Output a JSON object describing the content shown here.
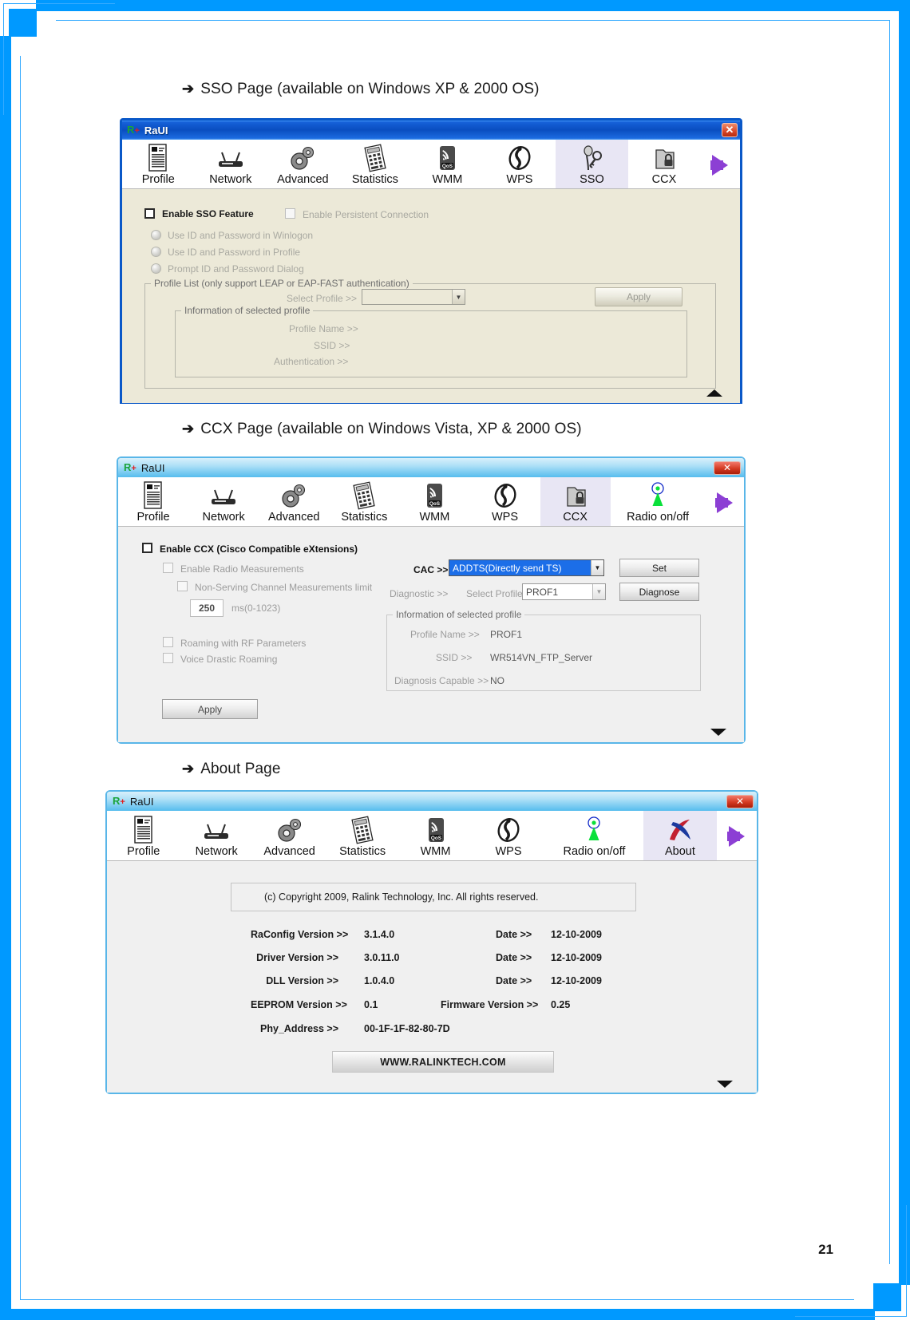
{
  "page": {
    "number": "21"
  },
  "sections": [
    {
      "id": "sso",
      "heading": "SSO Page (available on Windows XP & 2000 OS)"
    },
    {
      "id": "ccx",
      "heading": "CCX Page (available on Windows Vista, XP & 2000 OS)"
    },
    {
      "id": "about",
      "heading": "About Page"
    }
  ],
  "sso_window": {
    "title": "RaUI",
    "close_label": "✕",
    "tabs": [
      {
        "label": "Profile",
        "icon": "profile-icon",
        "selected": false
      },
      {
        "label": "Network",
        "icon": "network-icon",
        "selected": false
      },
      {
        "label": "Advanced",
        "icon": "advanced-icon",
        "selected": false
      },
      {
        "label": "Statistics",
        "icon": "statistics-icon",
        "selected": false
      },
      {
        "label": "WMM",
        "icon": "wmm-qos-icon",
        "selected": false
      },
      {
        "label": "WPS",
        "icon": "wps-icon",
        "selected": false
      },
      {
        "label": "SSO",
        "icon": "sso-icon",
        "selected": true
      },
      {
        "label": "CCX",
        "icon": "ccx-icon",
        "selected": false
      }
    ],
    "enable_sso": "Enable SSO Feature",
    "enable_persistent": "Enable Persistent Connection",
    "radios": [
      "Use ID and Password in Winlogon",
      "Use ID and Password in Profile",
      "Prompt ID and Password Dialog"
    ],
    "profile_list_title": "Profile List (only support LEAP or EAP-FAST authentication)",
    "select_profile_label": "Select Profile >>",
    "select_profile_value": "",
    "apply_label": "Apply",
    "info_group_title": "Information of selected profile",
    "info_rows": [
      {
        "label": "Profile Name >>",
        "value": ""
      },
      {
        "label": "SSID >>",
        "value": ""
      },
      {
        "label": "Authentication >>",
        "value": ""
      }
    ]
  },
  "ccx_window": {
    "title": "RaUI",
    "close_label": "✕",
    "tabs": [
      {
        "label": "Profile",
        "icon": "profile-icon",
        "selected": false
      },
      {
        "label": "Network",
        "icon": "network-icon",
        "selected": false
      },
      {
        "label": "Advanced",
        "icon": "advanced-icon",
        "selected": false
      },
      {
        "label": "Statistics",
        "icon": "statistics-icon",
        "selected": false
      },
      {
        "label": "WMM",
        "icon": "wmm-qos-icon",
        "selected": false
      },
      {
        "label": "WPS",
        "icon": "wps-icon",
        "selected": false
      },
      {
        "label": "CCX",
        "icon": "ccx-icon",
        "selected": true
      },
      {
        "label": "Radio on/off",
        "icon": "radio-onoff-icon",
        "selected": false
      }
    ],
    "enable_ccx": "Enable CCX (Cisco Compatible eXtensions)",
    "enable_radio_measurements": "Enable Radio Measurements",
    "non_serving": "Non-Serving Channel Measurements limit",
    "ms_value": "250",
    "ms_label": "ms(0-1023)",
    "roaming_rf": "Roaming with RF Parameters",
    "voice_drastic": "Voice Drastic Roaming",
    "cac_label": "CAC >>",
    "cac_value": "ADDTS(Directly send TS)",
    "set_label": "Set",
    "diagnostic_label": "Diagnostic >>",
    "select_profile_label": "Select Profile",
    "select_profile_value": "PROF1",
    "diagnose_label": "Diagnose",
    "info_group_title": "Information of selected profile",
    "info_rows": [
      {
        "label": "Profile Name >>",
        "value": "PROF1"
      },
      {
        "label": "SSID >>",
        "value": "WR514VN_FTP_Server"
      },
      {
        "label": "Diagnosis Capable >>",
        "value": "NO"
      }
    ],
    "apply_label": "Apply"
  },
  "about_window": {
    "title": "RaUI",
    "close_label": "✕",
    "tabs": [
      {
        "label": "Profile",
        "icon": "profile-icon",
        "selected": false
      },
      {
        "label": "Network",
        "icon": "network-icon",
        "selected": false
      },
      {
        "label": "Advanced",
        "icon": "advanced-icon",
        "selected": false
      },
      {
        "label": "Statistics",
        "icon": "statistics-icon",
        "selected": false
      },
      {
        "label": "WMM",
        "icon": "wmm-qos-icon",
        "selected": false
      },
      {
        "label": "WPS",
        "icon": "wps-icon",
        "selected": false
      },
      {
        "label": "Radio on/off",
        "icon": "radio-onoff-icon",
        "selected": false
      },
      {
        "label": "About",
        "icon": "about-icon",
        "selected": true
      }
    ],
    "copyright": "(c) Copyright 2009, Ralink Technology, Inc.  All rights reserved.",
    "rows": [
      {
        "label": "RaConfig Version >>",
        "value": "3.1.4.0",
        "label2": "Date >>",
        "value2": "12-10-2009"
      },
      {
        "label": "Driver Version >>",
        "value": "3.0.11.0",
        "label2": "Date >>",
        "value2": "12-10-2009"
      },
      {
        "label": "DLL Version >>",
        "value": "1.0.4.0",
        "label2": "Date >>",
        "value2": "12-10-2009"
      },
      {
        "label": "EEPROM Version >>",
        "value": "0.1",
        "label2": "Firmware Version >>",
        "value2": "0.25"
      },
      {
        "label": "Phy_Address >>",
        "value": "00-1F-1F-82-80-7D",
        "label2": "",
        "value2": ""
      }
    ],
    "website": "WWW.RALINKTECH.COM"
  },
  "colors": {
    "border_blue": "#0099ff",
    "xp_title": "#0a4ec0",
    "win7_title": "#7fcdf2",
    "selected_tab": "#e8e6f4",
    "accent_arrow": "#8c3fd4"
  }
}
